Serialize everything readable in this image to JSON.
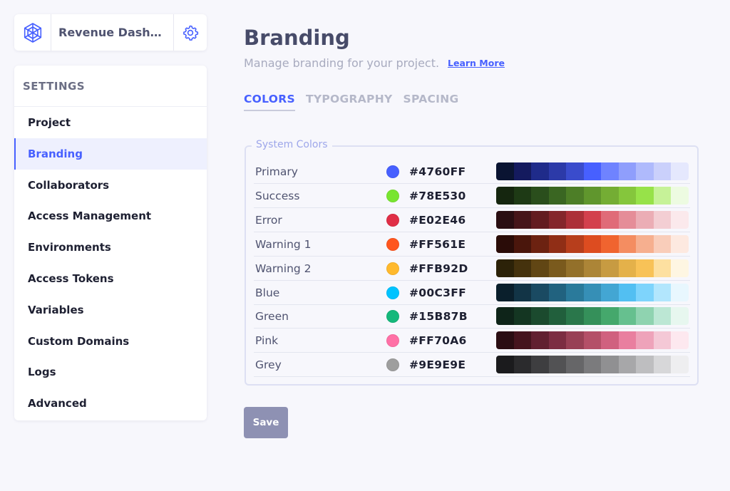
{
  "project": {
    "name": "Revenue Dashbo...",
    "logo_icon": "network-hexagon-icon",
    "settings_icon": "gear-icon"
  },
  "sidebar": {
    "header": "SETTINGS",
    "items": [
      {
        "label": "Project",
        "active": false
      },
      {
        "label": "Branding",
        "active": true
      },
      {
        "label": "Collaborators",
        "active": false
      },
      {
        "label": "Access Management",
        "active": false
      },
      {
        "label": "Environments",
        "active": false
      },
      {
        "label": "Access Tokens",
        "active": false
      },
      {
        "label": "Variables",
        "active": false
      },
      {
        "label": "Custom Domains",
        "active": false
      },
      {
        "label": "Logs",
        "active": false
      },
      {
        "label": "Advanced",
        "active": false
      }
    ]
  },
  "main": {
    "title": "Branding",
    "subtitle": "Manage branding for your project.",
    "learn_more": "Learn More",
    "tabs": [
      {
        "label": "COLORS",
        "active": true
      },
      {
        "label": "TYPOGRAPHY",
        "active": false
      },
      {
        "label": "SPACING",
        "active": false
      }
    ],
    "system_colors_label": "System Colors",
    "colors": [
      {
        "name": "Primary",
        "hex": "#4760FF",
        "palette": [
          "#0a1432",
          "#141a5e",
          "#1f2b8a",
          "#2c3aa8",
          "#3a4ccc",
          "#4760ff",
          "#6f83ff",
          "#8f9efc",
          "#afbafc",
          "#cad0fb",
          "#e5e8fd"
        ]
      },
      {
        "name": "Success",
        "hex": "#78E530",
        "palette": [
          "#15260f",
          "#1e3a15",
          "#2a4e1c",
          "#3a6622",
          "#4d7e27",
          "#60962d",
          "#74ad34",
          "#85c63c",
          "#97e249",
          "#c6f298",
          "#edfbe1"
        ]
      },
      {
        "name": "Error",
        "hex": "#E02E46",
        "palette": [
          "#2a0e12",
          "#461519",
          "#631c20",
          "#84262b",
          "#ac3038",
          "#d3404d",
          "#e06b78",
          "#e58d98",
          "#ebadb5",
          "#f3ced3",
          "#fbe9ec"
        ]
      },
      {
        "name": "Warning 1",
        "hex": "#FF561E",
        "palette": [
          "#2a0c08",
          "#4a160c",
          "#6c2211",
          "#902e16",
          "#b73e1c",
          "#dd4c20",
          "#f0642f",
          "#f48d61",
          "#f6af8f",
          "#f9cdba",
          "#fde9e0"
        ]
      },
      {
        "name": "Warning 2",
        "hex": "#FFB92D",
        "palette": [
          "#2c2208",
          "#45320d",
          "#614614",
          "#7a5a1d",
          "#93702a",
          "#ac8537",
          "#c79b42",
          "#e4b14a",
          "#f8c257",
          "#fde0a0",
          "#fef6e2"
        ]
      },
      {
        "name": "Blue",
        "hex": "#00C3FF",
        "palette": [
          "#0a1f2c",
          "#123446",
          "#1a4a62",
          "#21627f",
          "#2a7a9b",
          "#368fb6",
          "#43a6d3",
          "#52bff2",
          "#7ed4fc",
          "#b2e6fd",
          "#e8f7fe"
        ]
      },
      {
        "name": "Green",
        "hex": "#15B87B",
        "palette": [
          "#0e2419",
          "#143622",
          "#1b4a2e",
          "#215f3c",
          "#2a774b",
          "#35905a",
          "#45a86c",
          "#66c08f",
          "#8fd3b0",
          "#bce7d4",
          "#e7f7ef"
        ]
      },
      {
        "name": "Pink",
        "hex": "#FF70A6",
        "palette": [
          "#2a0d13",
          "#45141e",
          "#612030",
          "#7c2d42",
          "#984055",
          "#b45068",
          "#d0617f",
          "#e97f9f",
          "#eea3ba",
          "#f4c8d6",
          "#fde8ef"
        ]
      },
      {
        "name": "Grey",
        "hex": "#9E9E9E",
        "palette": [
          "#1b1b1d",
          "#2b2b2d",
          "#3e3e40",
          "#525254",
          "#666668",
          "#7b7b7d",
          "#909092",
          "#a7a7a9",
          "#bebec0",
          "#d7d7d9",
          "#eeeef0"
        ]
      }
    ],
    "save_label": "Save"
  },
  "colors": {
    "accent": "#4760FF",
    "save_button": "#8E91B3",
    "background": "#F7F7FC"
  }
}
